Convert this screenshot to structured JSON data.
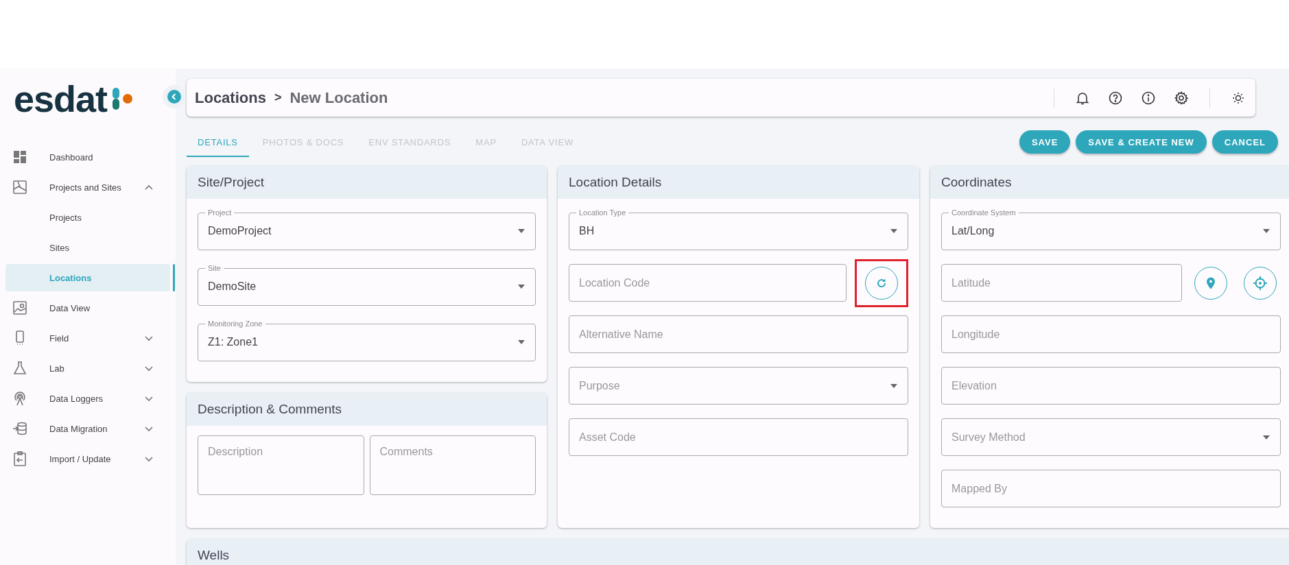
{
  "logo": {
    "text": "esdat"
  },
  "sidebar": {
    "items": [
      {
        "label": "Dashboard",
        "selected": false
      },
      {
        "label": "Projects and Sites",
        "selected": false,
        "expanded": true,
        "children": [
          {
            "label": "Projects",
            "selected": false
          },
          {
            "label": "Sites",
            "selected": false
          },
          {
            "label": "Locations",
            "selected": true
          }
        ]
      },
      {
        "label": "Data View",
        "selected": false
      },
      {
        "label": "Field",
        "selected": false,
        "expanded": false
      },
      {
        "label": "Lab",
        "selected": false,
        "expanded": false
      },
      {
        "label": "Data Loggers",
        "selected": false,
        "expanded": false
      },
      {
        "label": "Data Migration",
        "selected": false,
        "expanded": false
      },
      {
        "label": "Import / Update",
        "selected": false,
        "expanded": false
      }
    ]
  },
  "header": {
    "breadcrumb": [
      "Locations",
      "New Location"
    ],
    "separator": ">"
  },
  "tabs": [
    {
      "label": "DETAILS",
      "selected": true
    },
    {
      "label": "PHOTOS & DOCS",
      "selected": false
    },
    {
      "label": "ENV STANDARDS",
      "selected": false
    },
    {
      "label": "MAP",
      "selected": false
    },
    {
      "label": "DATA VIEW",
      "selected": false
    }
  ],
  "actions": [
    "SAVE",
    "SAVE & CREATE NEW",
    "CANCEL"
  ],
  "columns": [
    [
      {
        "title": "Site/Project",
        "fields": [
          {
            "kind": "select",
            "label": "Project",
            "value": "DemoProject"
          },
          {
            "kind": "select",
            "label": "Site",
            "value": "DemoSite"
          },
          {
            "kind": "select",
            "label": "Monitoring Zone",
            "value": "Z1: Zone1"
          }
        ]
      },
      {
        "title": "Description & Comments",
        "fields": [
          {
            "kind": "textarea",
            "placeholder": "Description"
          },
          {
            "kind": "textarea",
            "placeholder": "Comments"
          }
        ]
      }
    ],
    [
      {
        "title": "Location Details",
        "fields": [
          {
            "kind": "select",
            "label": "Location Type",
            "value": "BH"
          },
          {
            "kind": "text",
            "placeholder": "Location Code",
            "buttons": [
              {
                "kind": "regenerate",
                "highlighted": true
              }
            ]
          },
          {
            "kind": "text",
            "placeholder": "Alternative Name"
          },
          {
            "kind": "select",
            "placeholder": "Purpose"
          },
          {
            "kind": "text",
            "placeholder": "Asset Code"
          }
        ]
      }
    ],
    [
      {
        "title": "Coordinates",
        "fields": [
          {
            "kind": "select",
            "label": "Coordinate System",
            "value": "Lat/Long"
          },
          {
            "kind": "text",
            "placeholder": "Latitude",
            "buttons": [
              {
                "kind": "pin",
                "highlighted": false
              },
              {
                "kind": "locate",
                "highlighted": false
              }
            ]
          },
          {
            "kind": "text",
            "placeholder": "Longitude"
          },
          {
            "kind": "text",
            "placeholder": "Elevation"
          },
          {
            "kind": "select",
            "placeholder": "Survey Method"
          },
          {
            "kind": "text",
            "placeholder": "Mapped By"
          }
        ]
      }
    ]
  ],
  "wells": {
    "title": "Wells"
  }
}
